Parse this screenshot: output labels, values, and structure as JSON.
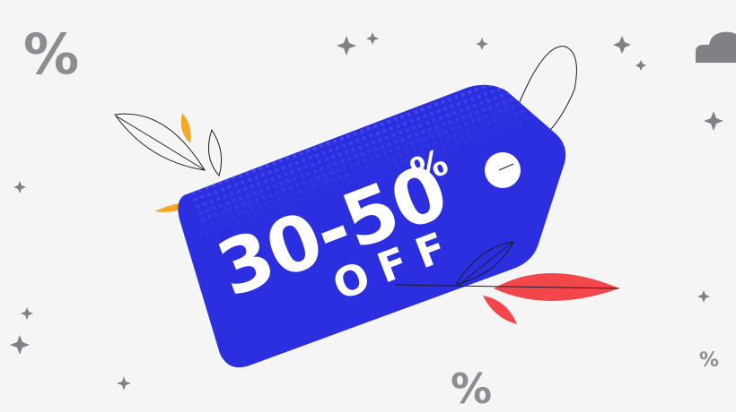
{
  "tag": {
    "range_text": "30-50",
    "percent_sign": "%",
    "off_text": "OFF",
    "colors": {
      "tag": "#2b2fe0",
      "tag_dots": "#5a5ef0",
      "white": "#ffffff"
    }
  },
  "decor": {
    "percent_marks": [
      "%",
      "%",
      "%"
    ],
    "colors": {
      "background": "#f5f5f6",
      "grey": "#8b8d92",
      "sparkle": "#7f8186",
      "leaf_red": "#f2464a",
      "leaf_orange": "#f5a623",
      "line": "#1a1a2e"
    },
    "icons": [
      "sparkle-icon",
      "cloud-icon",
      "leaf-icon"
    ]
  }
}
